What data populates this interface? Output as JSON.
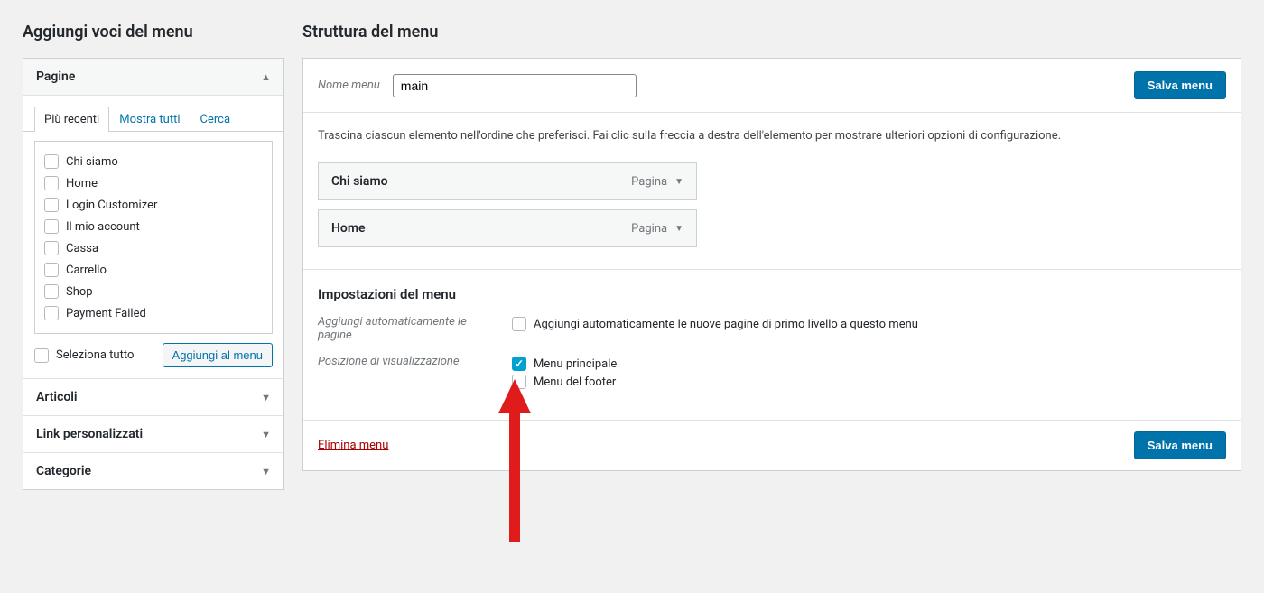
{
  "left": {
    "heading": "Aggiungi voci del menu",
    "panels": {
      "pages": "Pagine",
      "articles": "Articoli",
      "custom_links": "Link personalizzati",
      "categories": "Categorie"
    },
    "tabs": {
      "recent": "Più recenti",
      "all": "Mostra tutti",
      "search": "Cerca"
    },
    "pages_list": [
      "Chi siamo",
      "Home",
      "Login Customizer",
      "Il mio account",
      "Cassa",
      "Carrello",
      "Shop",
      "Payment Failed"
    ],
    "select_all": "Seleziona tutto",
    "add_to_menu": "Aggiungi al menu"
  },
  "right": {
    "heading": "Struttura del menu",
    "menu_name_label": "Nome menu",
    "menu_name_value": "main",
    "save_button": "Salva menu",
    "instructions": "Trascina ciascun elemento nell'ordine che preferisci. Fai clic sulla freccia a destra dell'elemento per mostrare ulteriori opzioni di configurazione.",
    "items": [
      {
        "title": "Chi siamo",
        "type": "Pagina"
      },
      {
        "title": "Home",
        "type": "Pagina"
      }
    ],
    "settings": {
      "title": "Impostazioni del menu",
      "auto_add_label": "Aggiungi automaticamente le pagine",
      "auto_add_text": "Aggiungi automaticamente le nuove pagine di primo livello a questo menu",
      "location_label": "Posizione di visualizzazione",
      "location_main": "Menu principale",
      "location_footer": "Menu del footer"
    },
    "delete_menu": "Elimina menu"
  }
}
